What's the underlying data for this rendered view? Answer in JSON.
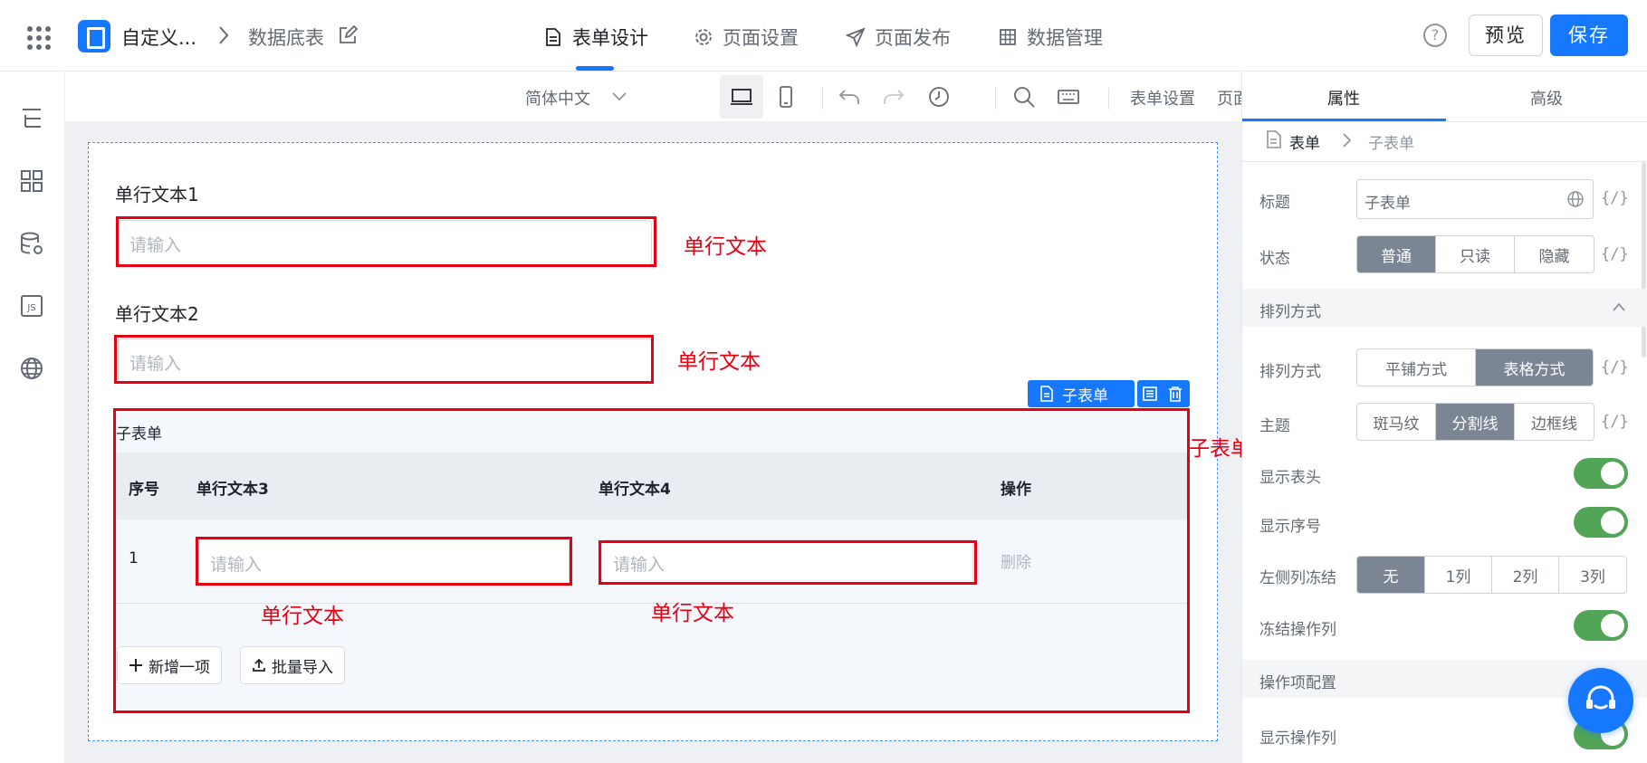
{
  "topbar": {
    "app_name": "自定义...",
    "breadcrumb_page": "数据底表",
    "tabs": [
      {
        "label": "表单设计",
        "icon": "document-icon"
      },
      {
        "label": "页面设置",
        "icon": "gear-icon"
      },
      {
        "label": "页面发布",
        "icon": "send-icon"
      },
      {
        "label": "数据管理",
        "icon": "table-icon"
      }
    ],
    "help": "?",
    "preview_label": "预览",
    "save_label": "保存"
  },
  "toolbar": {
    "language": "简体中文",
    "form_settings": "表单设置",
    "page_props": "页面属性"
  },
  "form": {
    "field1_label": "单行文本1",
    "field1_placeholder": "请输入",
    "field2_label": "单行文本2",
    "field2_placeholder": "请输入",
    "subform_tag": "子表单",
    "subform_title": "子表单",
    "columns": [
      "序号",
      "单行文本3",
      "单行文本4",
      "操作"
    ],
    "rows": [
      {
        "index": "1",
        "col3_placeholder": "请输入",
        "col4_placeholder": "请输入",
        "action": "删除"
      }
    ],
    "add_item": "新增一项",
    "batch_import": "批量导入"
  },
  "annotations": {
    "field1": "单行文本",
    "field2": "单行文本",
    "subform": "子表单",
    "col3": "单行文本",
    "col4": "单行文本"
  },
  "panel": {
    "tabs": [
      "属性",
      "高级"
    ],
    "breadcrumb_root": "表单",
    "breadcrumb_current": "子表单",
    "title_label": "标题",
    "title_value": "子表单",
    "expr": "{/}",
    "status_label": "状态",
    "status_options": [
      "普通",
      "只读",
      "隐藏"
    ],
    "status_selected": "普通",
    "section_layout": "排列方式",
    "layout_label": "排列方式",
    "layout_options": [
      "平铺方式",
      "表格方式"
    ],
    "layout_selected": "表格方式",
    "theme_label": "主题",
    "theme_options": [
      "斑马纹",
      "分割线",
      "边框线"
    ],
    "theme_selected": "分割线",
    "show_header_label": "显示表头",
    "show_header": true,
    "show_index_label": "显示序号",
    "show_index": true,
    "freeze_left_label": "左侧列冻结",
    "freeze_options": [
      "无",
      "1列",
      "2列",
      "3列"
    ],
    "freeze_selected": "无",
    "freeze_action_label": "冻结操作列",
    "freeze_action": true,
    "section_actions": "操作项配置",
    "show_action_col_label": "显示操作列",
    "show_action_col": true
  },
  "colors": {
    "accent": "#1677ff",
    "annotation_red": "#e60012",
    "toggle_on": "#52a457",
    "segment_on": "#7b8594"
  }
}
